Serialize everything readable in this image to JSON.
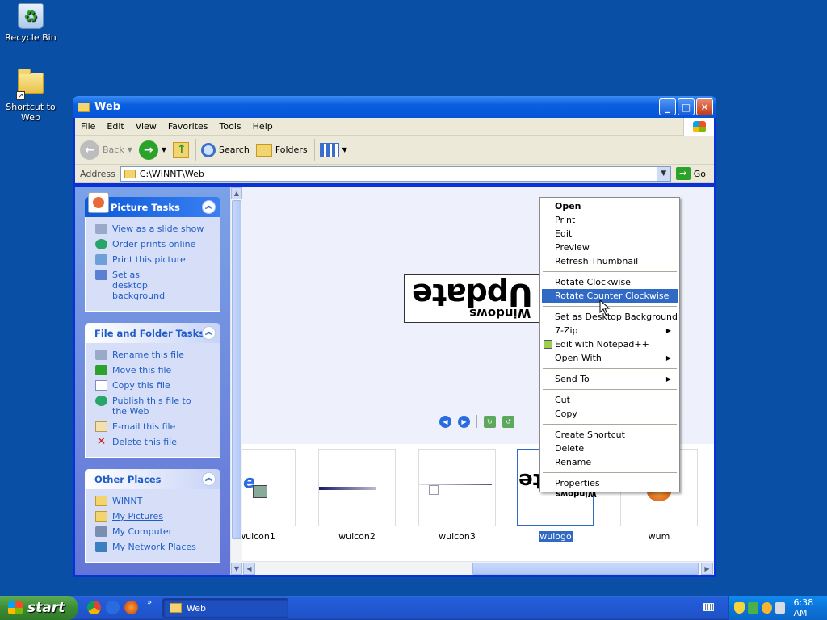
{
  "desktop": {
    "icons": [
      {
        "label": "Recycle Bin"
      },
      {
        "label": "Shortcut to Web"
      }
    ]
  },
  "window": {
    "title": "Web",
    "menu": [
      "File",
      "Edit",
      "View",
      "Favorites",
      "Tools",
      "Help"
    ],
    "toolbar": {
      "back_label": "Back",
      "search_label": "Search",
      "folders_label": "Folders"
    },
    "address": {
      "label": "Address",
      "value": "C:\\WINNT\\Web",
      "go_label": "Go"
    }
  },
  "taskpane": {
    "picture_tasks": {
      "title": "Picture Tasks",
      "items": [
        "View as a slide show",
        "Order prints online",
        "Print this picture",
        "Set as desktop background"
      ]
    },
    "file_folder_tasks": {
      "title": "File and Folder Tasks",
      "items": [
        "Rename this file",
        "Move this file",
        "Copy this file",
        "Publish this file to the Web",
        "E-mail this file",
        "Delete this file"
      ]
    },
    "other_places": {
      "title": "Other Places",
      "items": [
        "WINNT",
        "My Pictures",
        "My Computer",
        "My Network Places"
      ]
    }
  },
  "preview": {
    "image_text_large": "Update",
    "image_text_small": "Windows"
  },
  "filmstrip": {
    "items": [
      {
        "label": "wuicon1"
      },
      {
        "label": "wuicon2"
      },
      {
        "label": "wuicon3"
      },
      {
        "label": "wulogo",
        "selected": true
      },
      {
        "label": "wum"
      }
    ]
  },
  "context_menu": {
    "group1": [
      "Open",
      "Print",
      "Edit",
      "Preview",
      "Refresh Thumbnail"
    ],
    "group2": [
      "Rotate Clockwise",
      "Rotate Counter Clockwise"
    ],
    "group3": [
      "Set as Desktop Background",
      "7-Zip",
      "Edit with Notepad++",
      "Open With"
    ],
    "group4": [
      "Send To"
    ],
    "group5": [
      "Cut",
      "Copy"
    ],
    "group6": [
      "Create Shortcut",
      "Delete",
      "Rename"
    ],
    "group7": [
      "Properties"
    ],
    "highlighted": "Rotate Counter Clockwise"
  },
  "taskbar": {
    "start_label": "start",
    "task_label": "Web",
    "clock": "6:38 AM"
  },
  "colors": {
    "desktop": "#0a4fa6",
    "selection": "#316ac5",
    "titlebar": "#0554d8"
  }
}
